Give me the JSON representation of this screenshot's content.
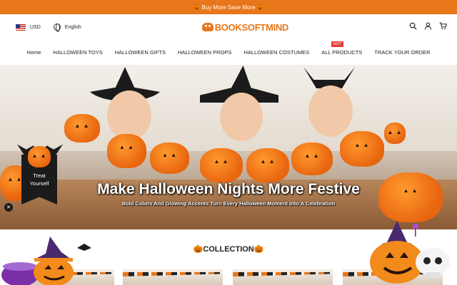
{
  "announcement": {
    "text": "Buy More Save More",
    "icon_left": "pumpkin-emoji",
    "icon_right": "pumpkin-emoji"
  },
  "header": {
    "currency": "USD",
    "language": "English",
    "logo_text": "BOOKSOFTMIND",
    "icons": [
      "search-icon",
      "user-icon",
      "cart-icon"
    ]
  },
  "nav": {
    "items": [
      {
        "label": "Home"
      },
      {
        "label": "HALLOWEEN TOYS"
      },
      {
        "label": "HALLOWEEN GIFTS"
      },
      {
        "label": "HALLOWEEN PROPS"
      },
      {
        "label": "HALLOWEEN COSTUMES"
      },
      {
        "label": "ALL PRODUCTS",
        "badge": "HOT"
      },
      {
        "label": "TRACK YOUR ORDER"
      }
    ]
  },
  "hero": {
    "title": "Make Halloween Nights More Festive",
    "subtitle": "Bold Colors And Glowing Accents Turn Every Halloween Moment Into A Celebration",
    "badge_text_line1": "Treat",
    "badge_text_line2": "Yourself"
  },
  "collection": {
    "title": "COLLECTION",
    "icon": "pumpkin-emoji"
  },
  "colors": {
    "accent": "#e8761a",
    "hot_badge": "#e53935"
  }
}
